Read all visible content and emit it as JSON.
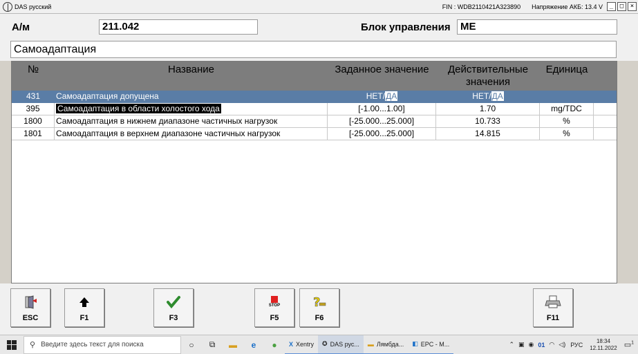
{
  "window": {
    "title": "DAS русский",
    "fin": "FIN : WDB2110421A323890",
    "voltage": "Напряжение АКБ: 13.4 V"
  },
  "header": {
    "am_label": "А/м",
    "am_value": "211.042",
    "unit_label": "Блок управления",
    "unit_value": "ME",
    "screen_title": "Самоадаптация"
  },
  "table": {
    "columns": [
      "№",
      "Название",
      "Заданное значение",
      "Действительные значения",
      "Единица"
    ],
    "rows": [
      {
        "num": "431",
        "name": "Самоадаптация допущена",
        "set": "НЕТ/ДА",
        "act": "НЕТ/ДА",
        "unit": ""
      },
      {
        "num": "395",
        "name": "Самоадаптация в области холостого хода",
        "set": "[-1.00...1.00]",
        "act": "1.70",
        "unit": "mg/TDC"
      },
      {
        "num": "1800",
        "name": "Самоадаптация в нижнем диапазоне частичных нагрузок",
        "set": "[-25.000...25.000]",
        "act": "10.733",
        "unit": "%"
      },
      {
        "num": "1801",
        "name": "Самоадаптация в верхнем диапазоне частичных нагрузок",
        "set": "[-25.000...25.000]",
        "act": "14.815",
        "unit": "%"
      }
    ],
    "yn": {
      "no": "НЕТ",
      "sep": "/",
      "yes": "ДА"
    }
  },
  "fkeys": {
    "esc": "ESC",
    "f1": "F1",
    "f3": "F3",
    "f5": "F5",
    "f5_stop": "STOP",
    "f6": "F6",
    "f11": "F11"
  },
  "taskbar": {
    "search_placeholder": "Введите здесь текст для поиска",
    "apps": [
      "Xentry",
      "DAS рус...",
      "Лямбда...",
      "EPC - M..."
    ],
    "tray_badge": "01",
    "lang": "РУС",
    "time": "18:34",
    "date": "12.11.2022",
    "notif_count": "1"
  },
  "colors": {
    "selected_row": "#5a7da6",
    "header_row": "#7d7d7d",
    "check": "#2e8b2e",
    "stop": "#e02020"
  }
}
